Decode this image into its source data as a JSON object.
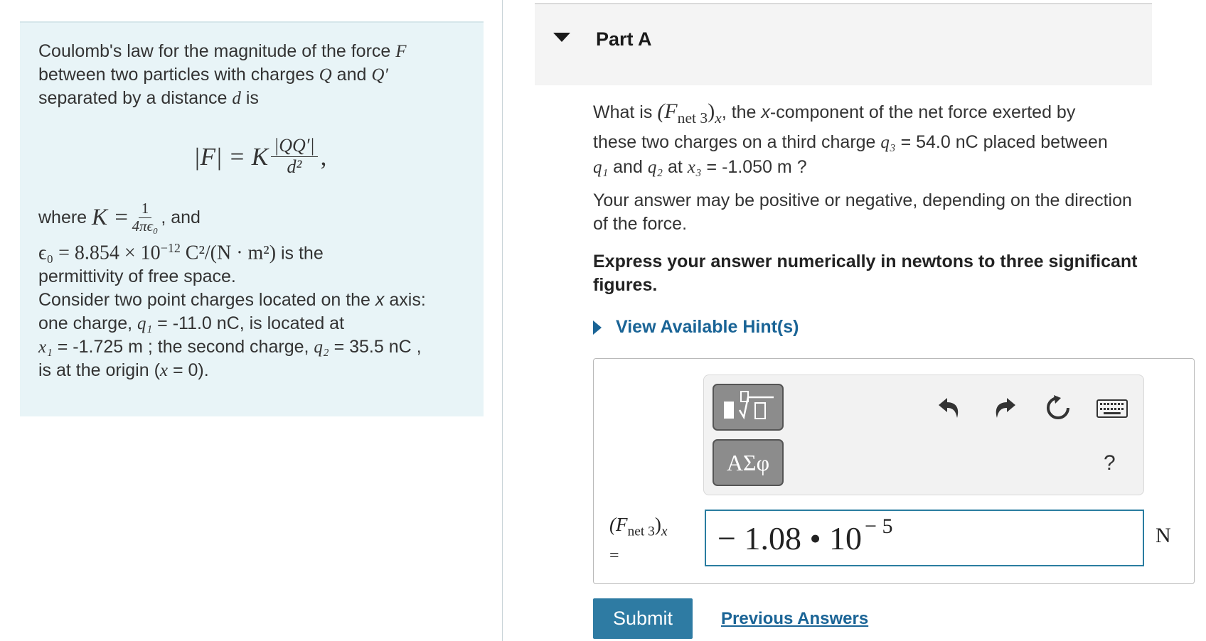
{
  "intro": {
    "line1": "Coulomb's law for the magnitude of the force",
    "var_F": "F",
    "line2a": "between two particles with charges",
    "var_Q": "Q",
    "and": "and",
    "var_Qp": "Q′",
    "line3a": "separated by a distance",
    "var_d": "d",
    "line3b": "is",
    "formula_lhs": "|F| = K",
    "formula_num": "|QQ′|",
    "formula_den": "d²",
    "formula_tail": ",",
    "where": "where",
    "k_lhs": "K =",
    "k_num": "1",
    "k_den": "4πϵ₀",
    "k_tail": ", and",
    "eps_expr": "ϵ₀ = 8.854 × 10",
    "eps_exp": "−12",
    "eps_units": "C²/(N · m²)",
    "eps_tail": "is the",
    "eps_line2": "permittivity of free space.",
    "consider_1": "Consider two point charges located on the",
    "consider_x": "x",
    "consider_2": "axis:",
    "consider_3": "one charge,",
    "q1": "q₁",
    "q1_val": "= -11.0 nC",
    "consider_4": ", is located at",
    "x1": "x₁",
    "x1_val": "= -1.725 m",
    "consider_5": "; the second charge,",
    "q2": "q₂",
    "q2_val": "= 35.5 nC",
    "consider_6": ",",
    "consider_7": "is at the origin (",
    "origin_x": "x",
    "origin_eq": "= 0).",
    "end": ""
  },
  "part": {
    "title": "Part A"
  },
  "question": {
    "q_a": "What is",
    "fnet": "(F",
    "fnet_sub": "net 3",
    "fnet_close": ")",
    "fnet_x": "x",
    "q_b": ", the",
    "q_xword": "x",
    "q_c": "-component of the net force exerted by",
    "q_d": "these two charges on a third charge",
    "q3": "q₃",
    "q3_val": "= 54.0 nC",
    "q_e": "placed between",
    "q1": "q₁",
    "q_f": "and",
    "q2": "q₂",
    "q_g": "at",
    "x3": "x₃",
    "x3_val": "= -1.050 m",
    "q_h": "?",
    "note": "Your answer may be positive or negative, depending on the direction of the force.",
    "express": "Express your answer numerically in newtons to three significant figures."
  },
  "hints": {
    "label": "View Available Hint(s)"
  },
  "answer": {
    "label_main": "(F",
    "label_sub": "net 3",
    "label_close": ")",
    "label_x": "x",
    "label_eq": "=",
    "value_mantissa": "− 1.08 • 10",
    "value_exp": "− 5",
    "unit": "N",
    "symbols_btn": "ΑΣφ",
    "help": "?"
  },
  "actions": {
    "submit": "Submit",
    "previous": "Previous Answers"
  },
  "colors": {
    "intro_bg": "#e8f4f7",
    "accent": "#2e7ba3",
    "link": "#1a6496"
  },
  "icons": [
    "templates-icon",
    "undo-icon",
    "redo-icon",
    "reset-icon",
    "keyboard-icon",
    "help-icon",
    "caret-down-icon",
    "caret-right-icon"
  ]
}
